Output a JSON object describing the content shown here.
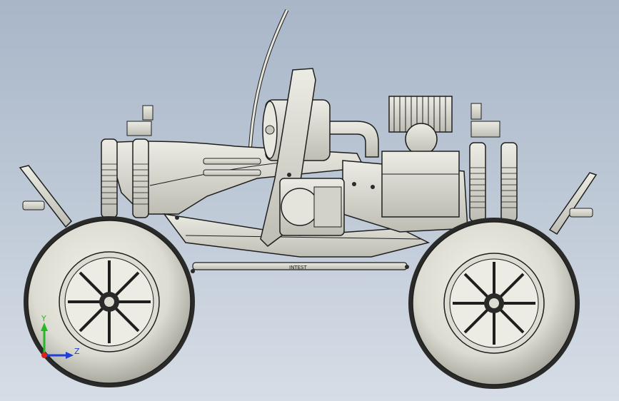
{
  "viewport": {
    "background_top": "#a8b6c8",
    "background_bottom": "#d6dde6"
  },
  "model": {
    "body_color": "#dcdcd2",
    "shade_color": "#b9b9b0",
    "line_color": "#1e1e1e",
    "chassis_plate_text": "INTEST"
  },
  "triad": {
    "x_label": "X",
    "y_label": "Y",
    "z_label": "Z",
    "x_color": "#e0201c",
    "y_color": "#26b826",
    "z_color": "#1f3fd8"
  }
}
